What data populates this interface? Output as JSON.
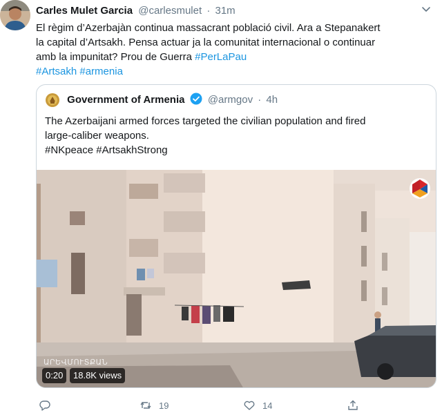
{
  "tweet": {
    "author_name": "Carles Mulet Garcia",
    "author_handle": "@carlesmulet",
    "separator": "·",
    "time": "31m",
    "text_lines": [
      "El règim d’Azerbajàn continua massacrant població civil. Ara  a Stepanakert",
      "la capital d’Artsakh. Pensa actuar ja la comunitat internacional o continuar",
      "amb la impunitat? Prou de Guerra"
    ],
    "inline_hashtag": "#PerLaPau",
    "hashtags": [
      "#Artsakh",
      "#armenia"
    ]
  },
  "quoted": {
    "author_name": "Government of Armenia",
    "author_handle": "@armgov",
    "separator": "·",
    "time": "4h",
    "text_lines": [
      "The Azerbaijani armed forces targeted the civilian population and fired",
      "large-caliber weapons."
    ],
    "hashtags": [
      "#NKpeace",
      "#ArtsakhStrong"
    ],
    "video": {
      "duration": "0:20",
      "views": "18.8K views",
      "watermark": "ԱՐԵՎՄՈՒՏՔԱՆ"
    }
  },
  "actions": {
    "reply_count": "",
    "retweet_count": "19",
    "like_count": "14"
  },
  "colors": {
    "link": "#1b95e0",
    "secondary": "#657786",
    "verified": "#1da1f2",
    "border": "#ccd6dd"
  },
  "icons": [
    "more-icon",
    "verified-icon",
    "reply-icon",
    "retweet-icon",
    "like-icon",
    "share-icon",
    "government-seal-icon",
    "channel-logo-icon"
  ]
}
